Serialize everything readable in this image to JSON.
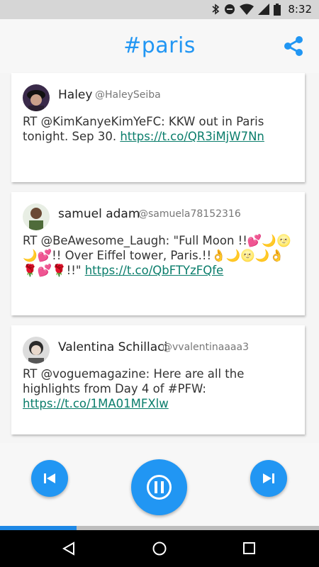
{
  "status_bar": {
    "time": "8:32",
    "icons": [
      "bluetooth-icon",
      "do-not-disturb-icon",
      "wifi-icon",
      "signal-icon",
      "battery-icon"
    ]
  },
  "app_bar": {
    "title": "#paris",
    "share_icon": "share-icon",
    "accent_color": "#2196f3"
  },
  "tweets": [
    {
      "name": "Haley",
      "handle": "@HaleySeiba",
      "text_prefix": "RT @KimKanyeKimYeFC: KKW out in Paris tonight. Sep 30. ",
      "link": "https://t.co/QR3iMjW7Nn"
    },
    {
      "name": "samuel adam",
      "handle": "@samuela78152316",
      "text_prefix": "RT @BeAwesome_Laugh: \"Full Moon !!💕🌙🌝🌙💕!! Over Eiffel tower, Paris.!!👌🌙🌝🌙👌🌹💕🌹!!\" ",
      "link": "https://t.co/QbFTYzFQfe"
    },
    {
      "name": "Valentina Schillaci",
      "handle": "@vvalentinaaaa3",
      "text_prefix": "RT @voguemagazine: Here are all the highlights from Day 4 of #PFW: ",
      "link": "https://t.co/1MA01MFXlw"
    }
  ],
  "controls": {
    "previous_icon": "skip-previous-icon",
    "pause_icon": "pause-icon",
    "next_icon": "skip-next-icon"
  },
  "progress": {
    "fraction": 0.24
  },
  "nav_bar": {
    "back_icon": "back-icon",
    "home_icon": "home-icon",
    "recents_icon": "recents-icon"
  }
}
